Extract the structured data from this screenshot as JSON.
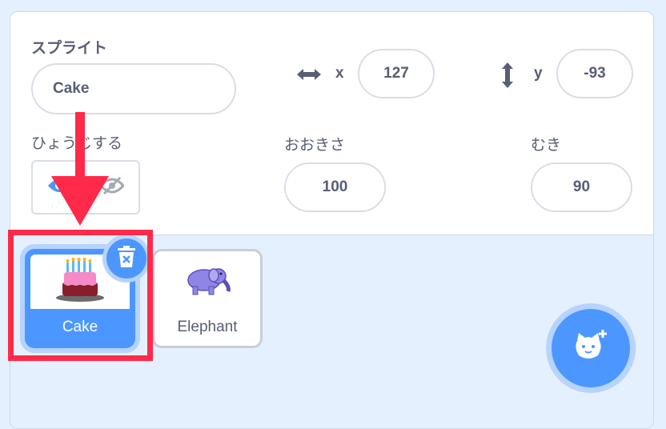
{
  "sprite_info": {
    "sprite_label": "スプライト",
    "sprite_name": "Cake",
    "x_label": "x",
    "x_value": "127",
    "y_label": "y",
    "y_value": "-93",
    "show_label": "ひょうじする",
    "size_label": "おおきさ",
    "size_value": "100",
    "direction_label": "むき",
    "direction_value": "90"
  },
  "sprites": [
    {
      "name": "Cake",
      "selected": true
    },
    {
      "name": "Elephant",
      "selected": false
    }
  ],
  "colors": {
    "accent": "#4c97ff",
    "highlight": "#ff2a4a",
    "text": "#575e75"
  }
}
